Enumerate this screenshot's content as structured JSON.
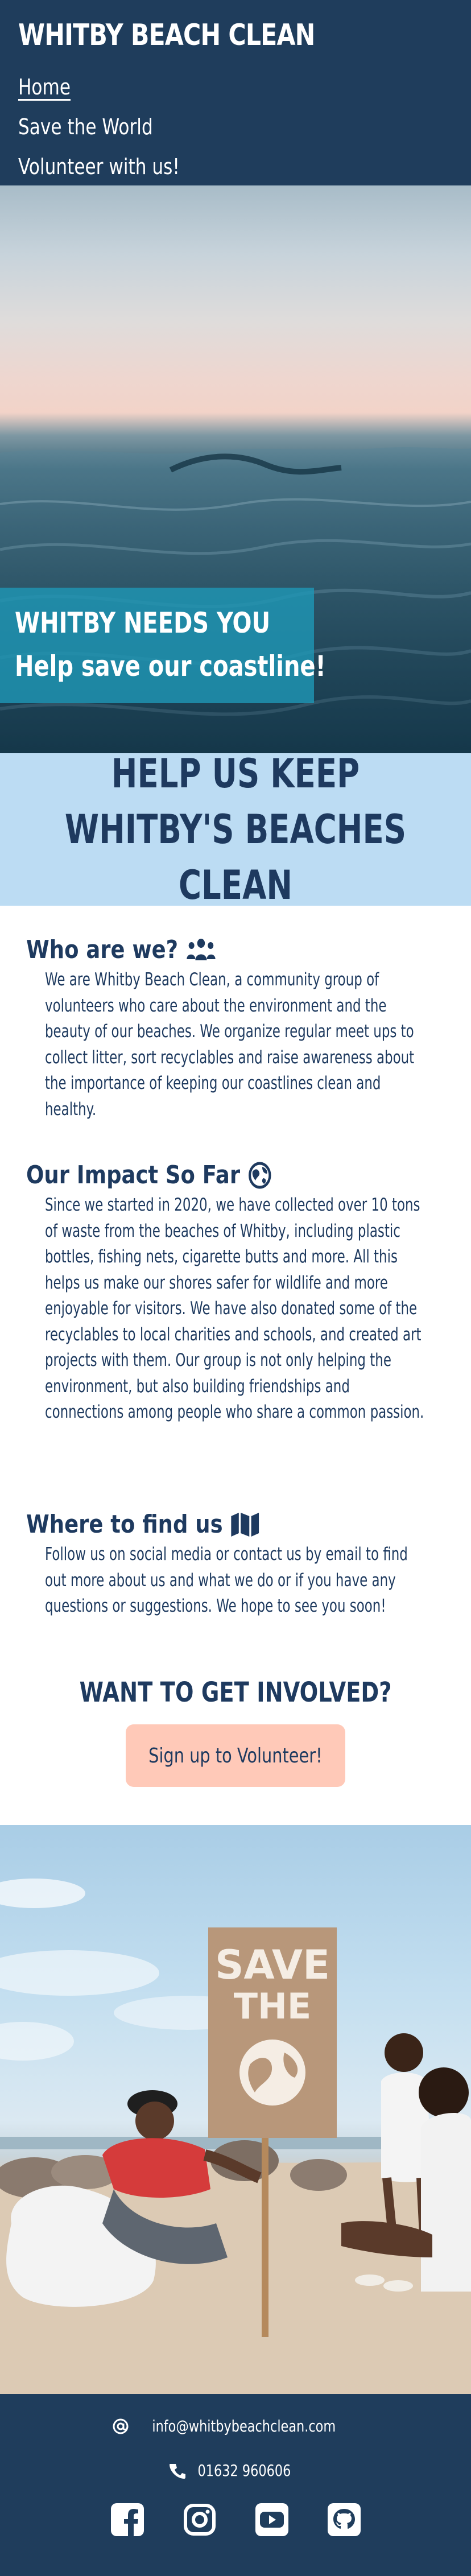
{
  "header": {
    "site_title": "WHITBY BEACH CLEAN",
    "nav": [
      {
        "label": "Home",
        "active": true
      },
      {
        "label": "Save the World",
        "active": false
      },
      {
        "label": "Volunteer with us!",
        "active": false
      }
    ]
  },
  "hero": {
    "line1": "WHITBY NEEDS YOU",
    "line2": "Help save our coastline!"
  },
  "headline": "HELP US KEEP WHITBY'S BEACHES CLEAN",
  "sections": [
    {
      "heading": "Who are we?",
      "icon": "people-group-icon",
      "body": "We are Whitby Beach Clean, a community group of volunteers who care about the environment and the beauty of our beaches. We organize regular meet ups to collect litter, sort recyclables and raise awareness about the importance of keeping our coastlines clean and healthy."
    },
    {
      "heading": "Our Impact So Far",
      "icon": "earth-icon",
      "body": "Since we started in 2020, we have collected over 10 tons of waste from the beaches of Whitby, including plastic bottles, fishing nets, cigarette butts and more. All this helps us make our shores safer for wildlife and more enjoyable for visitors. We have also donated some of the recyclables to local charities and schools, and created art projects with them. Our group is not only helping the environment, but also building friendships and connections among people who share a common passion."
    },
    {
      "heading": "Where to find us",
      "icon": "map-icon",
      "body": "Follow us on social media or contact us by email to find out more about us and what we do or if you have any questions or suggestions. We hope to see you soon!"
    }
  ],
  "cta": {
    "heading": "WANT TO GET INVOLVED?",
    "button": "Sign up to Volunteer!"
  },
  "photo": {
    "sign_text_line1": "SAVE",
    "sign_text_line2": "THE"
  },
  "footer": {
    "email": "info@whitbybeachclean.com",
    "phone": "01632 960606",
    "social": [
      "facebook-icon",
      "instagram-icon",
      "youtube-icon",
      "github-icon"
    ]
  },
  "colors": {
    "navy": "#1f3d5c",
    "light_blue": "#bcdcf3",
    "teal_banner": "#1e96b4",
    "cta_peach": "#ffc9b8"
  }
}
